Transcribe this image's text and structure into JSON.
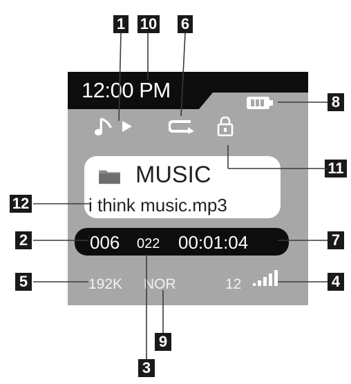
{
  "screen": {
    "time": "12:00 PM",
    "folder_name": "MUSIC",
    "filename": "i think music.mp3",
    "track_number": "006",
    "total_tracks": "022",
    "elapsed_time": "00:01:04",
    "bitrate": "192K",
    "eq_mode": "NOR",
    "volume": "12",
    "icons": {
      "music_note": "music-note-icon",
      "play": "play-icon",
      "repeat": "repeat-icon",
      "lock": "lock-icon",
      "battery": "battery-icon",
      "folder": "folder-icon",
      "signal": "signal-bars-icon"
    }
  },
  "callouts": {
    "c1": "1",
    "c10": "10",
    "c6": "6",
    "c8": "8",
    "c11": "11",
    "c12": "12",
    "c2": "2",
    "c7": "7",
    "c5": "5",
    "c4": "4",
    "c9": "9",
    "c3": "3"
  },
  "colors": {
    "screen_bg": "#a7a7a7",
    "dark": "#0d0d0d",
    "callout_bg": "#1a1a1a",
    "icon_light": "#ffffff"
  }
}
